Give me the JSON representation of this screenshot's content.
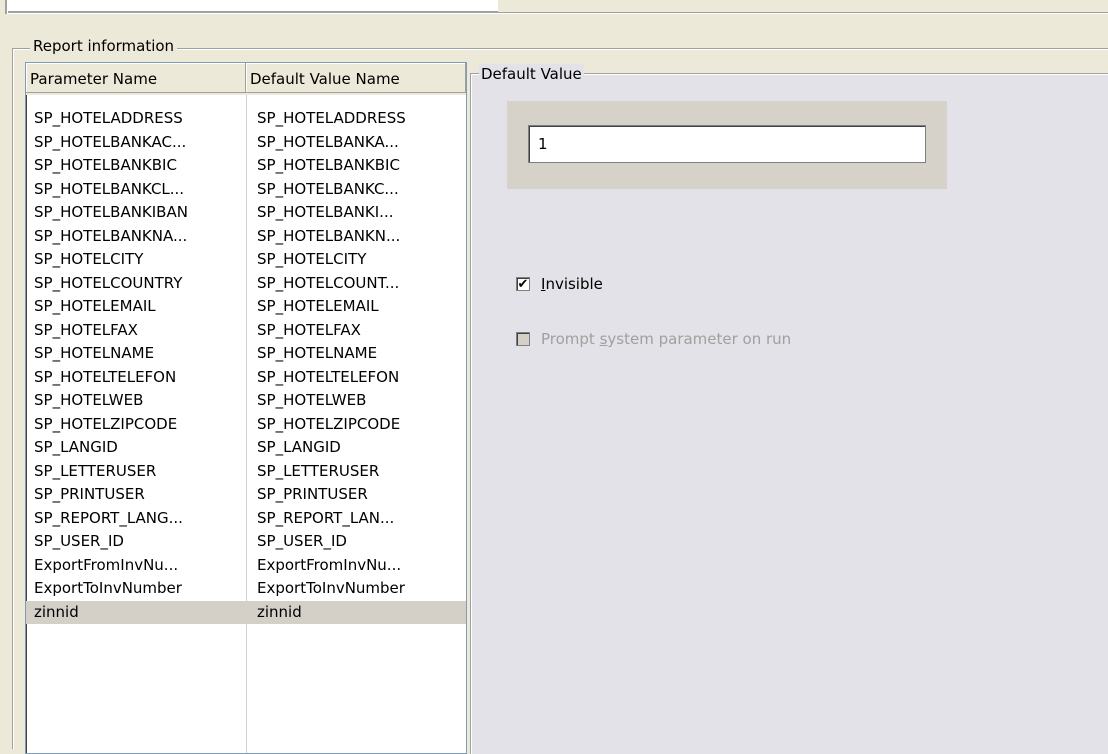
{
  "report_group": {
    "legend": "Report information"
  },
  "param_list": {
    "columns": [
      "Parameter Name",
      "Default Value Name"
    ],
    "rows": [
      [
        "SP_HOTELADDRESS",
        "SP_HOTELADDRESS"
      ],
      [
        "SP_HOTELBANKAC...",
        "SP_HOTELBANKA..."
      ],
      [
        "SP_HOTELBANKBIC",
        "SP_HOTELBANKBIC"
      ],
      [
        "SP_HOTELBANKCL...",
        "SP_HOTELBANKC..."
      ],
      [
        "SP_HOTELBANKIBAN",
        "SP_HOTELBANKI..."
      ],
      [
        "SP_HOTELBANKNA...",
        "SP_HOTELBANKN..."
      ],
      [
        "SP_HOTELCITY",
        "SP_HOTELCITY"
      ],
      [
        "SP_HOTELCOUNTRY",
        "SP_HOTELCOUNT..."
      ],
      [
        "SP_HOTELEMAIL",
        "SP_HOTELEMAIL"
      ],
      [
        "SP_HOTELFAX",
        "SP_HOTELFAX"
      ],
      [
        "SP_HOTELNAME",
        "SP_HOTELNAME"
      ],
      [
        "SP_HOTELTELEFON",
        "SP_HOTELTELEFON"
      ],
      [
        "SP_HOTELWEB",
        "SP_HOTELWEB"
      ],
      [
        "SP_HOTELZIPCODE",
        "SP_HOTELZIPCODE"
      ],
      [
        "SP_LANGID",
        "SP_LANGID"
      ],
      [
        "SP_LETTERUSER",
        "SP_LETTERUSER"
      ],
      [
        "SP_PRINTUSER",
        "SP_PRINTUSER"
      ],
      [
        "SP_REPORT_LANG...",
        "SP_REPORT_LAN..."
      ],
      [
        "SP_USER_ID",
        "SP_USER_ID"
      ],
      [
        "ExportFromInvNu...",
        "ExportFromInvNu..."
      ],
      [
        "ExportToInvNumber",
        "ExportToInvNumber"
      ],
      [
        "zinnid",
        "zinnid"
      ]
    ],
    "selected_row": 21
  },
  "default_value": {
    "legend": "Default Value",
    "value": "1",
    "invisible": {
      "label_accel": "I",
      "label_rest": "nvisible",
      "checked": true,
      "check_glyph": "✔"
    },
    "prompt": {
      "label_pre": "Prompt ",
      "label_accel": "s",
      "label_post": "ystem parameter on run",
      "checked": false,
      "enabled": false
    }
  }
}
